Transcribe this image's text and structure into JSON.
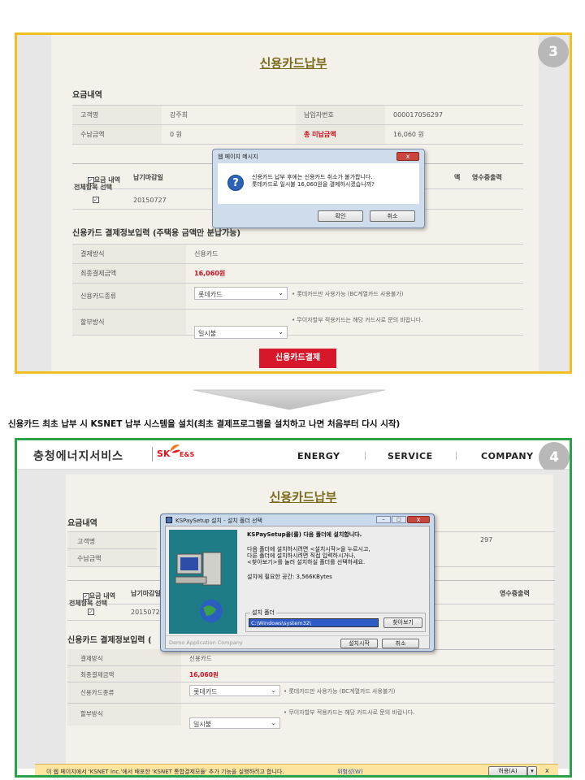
{
  "panel3": {
    "badge": "3",
    "title": "신용카드납부",
    "section_billing": "요금내역",
    "billing": {
      "customer_label": "고객명",
      "customer_value": "강주희",
      "payer_no_label": "납입자번호",
      "payer_no_value": "000017056297",
      "amount_label": "수납금액",
      "amount_value": "0 원",
      "unpaid_label": "총 미납금액",
      "unpaid_value": "16,060 원"
    },
    "detail_headers": {
      "select": "요금 내역\n전체항목 선택",
      "due": "납기마감일",
      "frag": "액",
      "receipt": "영수증출력"
    },
    "detail_row": {
      "due": "20150727"
    },
    "section_payinfo": "신용카드 결제정보입력 (주택용 금액만 분납가능)",
    "payinfo": {
      "method_label": "결제방식",
      "method_value": "신용카드",
      "final_label": "최종결제금액",
      "final_value": "16,060원",
      "card_type_label": "신용카드종류",
      "card_type_value": "롯데카드",
      "card_type_note": "• 롯데카드만 사용가능 (BC계열카드 사용불가)",
      "install_label": "할부방식",
      "install_value": "일시불",
      "install_note": "• 무이자할부 적용카드는 해당 카드사로 문의 바랍니다."
    },
    "pay_button": "신용카드결제",
    "dialog": {
      "title": "웹 페이지 메시지",
      "line1": "신용카드 납부 후에는 신용카드 취소가 불가합니다.",
      "line2": "롯데카드로 일시불 16,060원을 결제하시겠습니까?",
      "ok": "확인",
      "cancel": "취소",
      "close": "x"
    }
  },
  "caption": "신용카드 최초 납부 시 KSNET 납부 시스템을 설치(최초 결제프로그램을 설치하고 나면 처음부터 다시 시작)",
  "panel4": {
    "badge": "4",
    "logo": "충청에너지서비스",
    "logo_sk": "SK",
    "logo_es": "E&S",
    "nav": [
      "ENERGY",
      "SERVICE",
      "COMPANY"
    ],
    "title": "신용카드납부",
    "section_billing": "요금내역",
    "billing": {
      "customer_label": "고객명",
      "amount_label": "수납금액",
      "payer_tail": "297"
    },
    "detail_headers": {
      "select": "요금 내역\n전체항목 선택",
      "due": "납기마감일",
      "receipt": "영수증출력"
    },
    "detail_row": {
      "due": "2015072"
    },
    "section_payinfo": "신용카드 결제정보입력 (",
    "payinfo": {
      "method_label": "결제방식",
      "method_value": "신용카드",
      "final_label": "최종결제금액",
      "final_value": "16,060원",
      "card_type_label": "신용카드종류",
      "card_type_value": "롯데카드",
      "card_type_note": "• 롯데카드만 사용가능 (BC계열카드 사용불가)",
      "install_label": "할부방식",
      "install_value": "일시불",
      "install_note": "• 무이자할부 적용카드는 해당 카드사로 문의 바랍니다."
    },
    "setup_dialog": {
      "title": "KSPaySetup 설치 - 설치 폴더 선택",
      "line1": "KSPaySetup을(를) 다음 폴더에 설치합니다.",
      "line2": "다음 폴더에 설치하시려면 <설치시작>을 누르시고,",
      "line3": "다른 폴더에 설치하시려면 직접 입력하시거나,",
      "line4": "<찾아보기>를 눌러 설치하실 폴더를 선택하세요.",
      "space": "설치에 필요한 공간: 3,566KBytes",
      "folder_label": "설치 폴더",
      "folder_value": "C:\\Windows\\system32\\",
      "browse": "찾아보기",
      "footer": "Demo Application Company",
      "install": "설치시작",
      "cancel": "취소"
    },
    "infobar": {
      "message": "이 웹 페이지에서 'KSNET Inc.'에서 배포한 'KSNET 통합결제모듈' 추가 기능을 실행하려고 합니다.",
      "risk": "위험성(W)",
      "allow": "허용(A)",
      "close": "x"
    }
  }
}
